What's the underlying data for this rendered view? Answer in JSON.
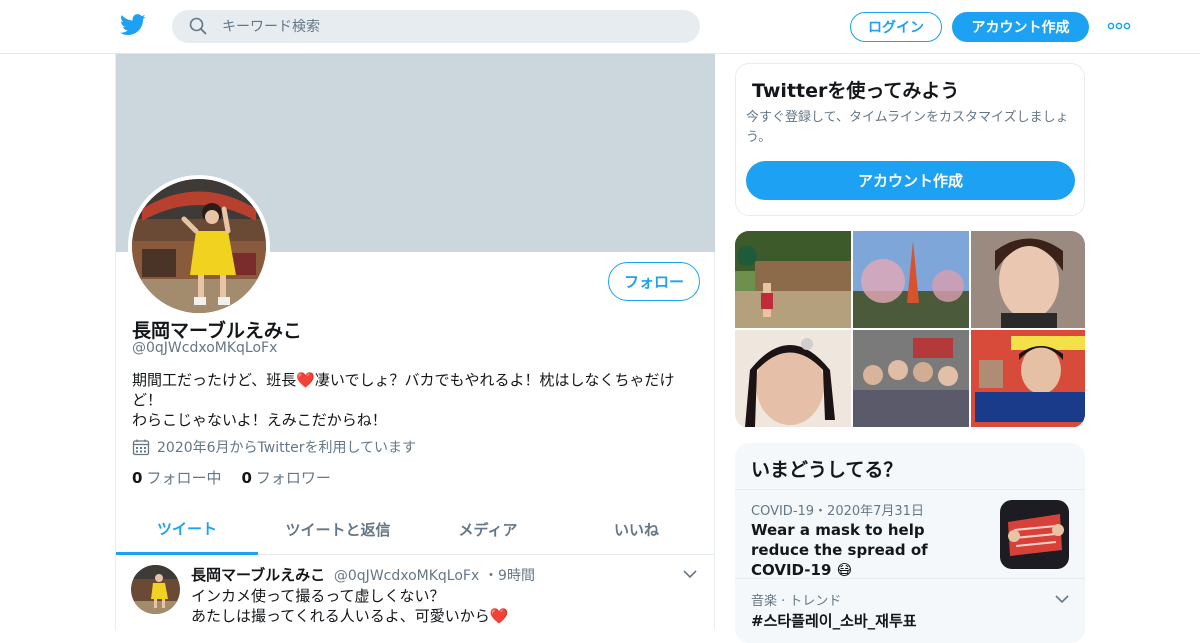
{
  "header": {
    "search_placeholder": "キーワード検索",
    "login_label": "ログイン",
    "signup_label": "アカウント作成",
    "brand_color": "#1da1f2",
    "icons": [
      "twitter-bird-icon",
      "search-icon",
      "more-dots-icon"
    ]
  },
  "profile": {
    "display_name": "長岡マーブルえみこ",
    "handle": "@0qJWcdxoMKqLoFx",
    "follow_label": "フォロー",
    "bio_line1": "期間工だったけど、班長❤️凄いでしょ？バカでもやれるよ！枕はしなくちゃだけど！",
    "bio_line2": "わらこじゃないよ！えみこだからね！",
    "joined": "2020年6月からTwitterを利用しています",
    "following_count": "0",
    "following_label": "フォロー中",
    "followers_count": "0",
    "followers_label": "フォロワー"
  },
  "tabs": [
    {
      "label": "ツイート",
      "active": true
    },
    {
      "label": "ツイートと返信",
      "active": false
    },
    {
      "label": "メディア",
      "active": false
    },
    {
      "label": "いいね",
      "active": false
    }
  ],
  "tweet": {
    "name": "長岡マーブルえみこ",
    "handle": "@0qJWcdxoMKqLoFx",
    "time": "・9時間",
    "text": "インカメ使って撮るって虚しくない？\nあたしは撮ってくれる人いるよ、可愛いから❤️"
  },
  "signup_card": {
    "title": "Twitterを使ってみよう",
    "description": "今すぐ登録して、タイムラインをカスタマイズしましょう。",
    "button_label": "アカウント作成"
  },
  "trends": {
    "title": "いまどうしてる？",
    "item1_meta": "COVID-19・2020年7月31日",
    "item1_headline": "Wear a mask to help reduce the spread of COVID-19 😷",
    "item2_meta": "音楽 · トレンド",
    "item2_tag": "#스타플레이_소바_재투표"
  }
}
